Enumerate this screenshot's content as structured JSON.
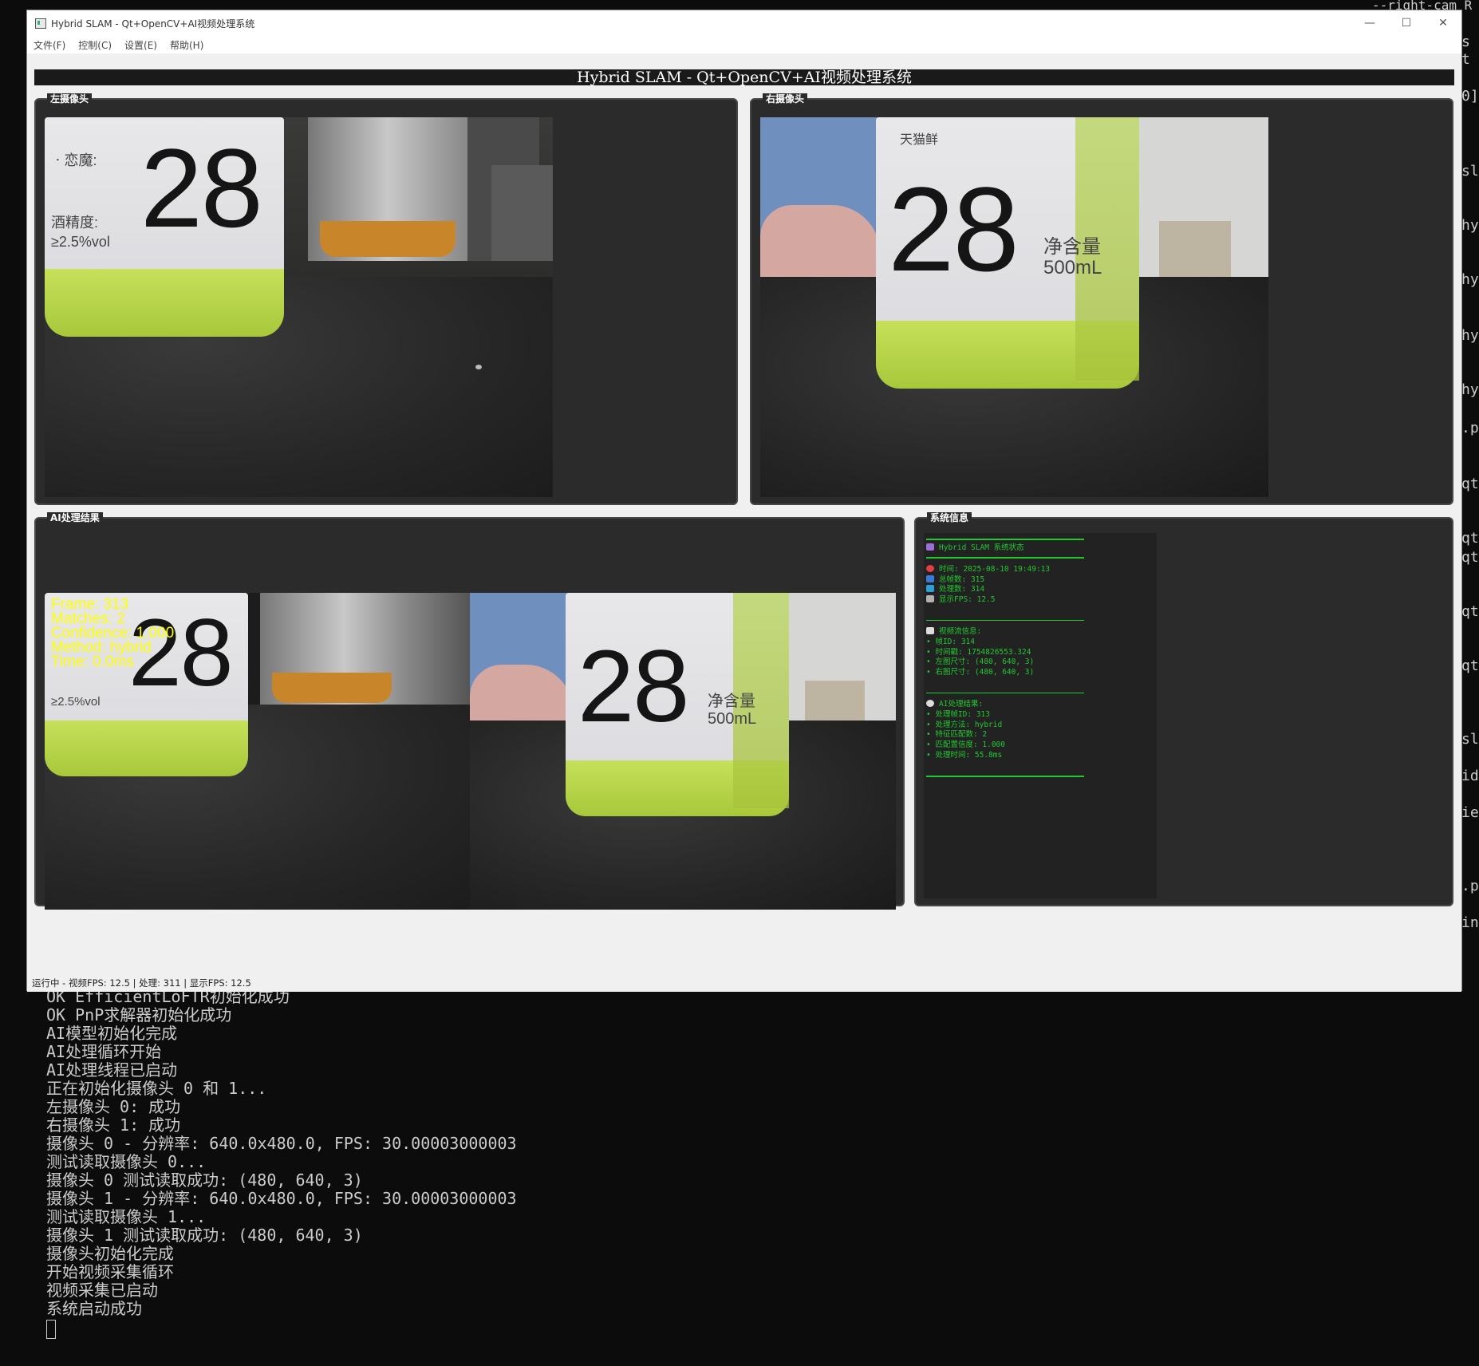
{
  "window": {
    "title": "Hybrid SLAM - Qt+OpenCV+AI视频处理系统",
    "controls": {
      "minimize": "—",
      "maximize": "☐",
      "close": "✕"
    }
  },
  "menu": [
    {
      "label": "文件(F)"
    },
    {
      "label": "控制(C)"
    },
    {
      "label": "设置(E)"
    },
    {
      "label": "帮助(H)"
    }
  ],
  "banner": "Hybrid SLAM - Qt+OpenCV+AI视频处理系统",
  "panels": {
    "left_camera": "左摄像头",
    "right_camera": "右摄像头",
    "ai_result": "AI处理结果",
    "system_info": "系统信息"
  },
  "camera_scene": {
    "bottle_number": "28",
    "left_label_small": "ㆍ恋魔:",
    "left_label_mid": "酒精度:",
    "left_label_alc": "≥2.5%vol",
    "right_label_volume": "净含量\n500mL",
    "right_label_brand": "天猫鲜"
  },
  "ai_overlay": {
    "frame": "Frame: 313",
    "matches": "Matches: 2",
    "confidence": "Confidence: 1.000",
    "method": "Method: hybrid",
    "time": "Time: 0.0ms"
  },
  "system_info": {
    "header": "Hybrid SLAM 系统状态",
    "time": "时间: 2025-08-10 19:49:13",
    "total_frames": "总帧数: 315",
    "processed": "处理数: 314",
    "display_fps": "显示FPS: 12.5",
    "video_title": "视频流信息:",
    "video_lines": [
      "• 帧ID: 314",
      "• 时间戳: 1754826553.324",
      "• 左图尺寸: (480, 640, 3)",
      "• 右图尺寸: (480, 640, 3)"
    ],
    "ai_title": "AI处理结果:",
    "ai_lines": [
      "• 处理帧ID: 313",
      "• 处理方法: hybrid",
      "• 特征匹配数: 2",
      "• 匹配置信度: 1.000",
      "• 处理时间: 55.8ms"
    ],
    "icon_colors": {
      "header": "#9b6fd6",
      "time": "#e04040",
      "total": "#3a7ad8",
      "processed": "#2aa0d8",
      "fps": "#b0b0b0",
      "video": "#dddddd",
      "ai": "#dddddd"
    }
  },
  "status_bar": "运行中 - 视频FPS: 12.5 | 处理: 311 | 显示FPS: 12.5",
  "terminal": {
    "lines": [
      "OK EfficientLoFTR初始化成功",
      "OK PnP求解器初始化成功",
      "AI模型初始化完成",
      "AI处理循环开始",
      "AI处理线程已启动",
      "正在初始化摄像头 0 和 1...",
      "左摄像头 0: 成功",
      "右摄像头 1: 成功",
      "摄像头 0 - 分辨率: 640.0x480.0, FPS: 30.00003000003",
      "测试读取摄像头 0...",
      "摄像头 0 测试读取成功: (480, 640, 3)",
      "摄像头 1 - 分辨率: 640.0x480.0, FPS: 30.00003000003",
      "测试读取摄像头 1...",
      "摄像头 1 测试读取成功: (480, 640, 3)",
      "摄像头初始化完成",
      "开始视频采集循环",
      "视频采集已启动",
      "系统启动成功"
    ],
    "top_right": "--right-cam R",
    "right_edge": [
      {
        "t": "s"
      },
      {
        "t": "t"
      },
      {
        "t": "0]"
      },
      {
        "t": "sl"
      },
      {
        "t": "hy"
      },
      {
        "t": "hy"
      },
      {
        "t": "hy"
      },
      {
        "t": "hy"
      },
      {
        "t": ".p"
      },
      {
        "t": "qt"
      },
      {
        "t": "qt"
      },
      {
        "t": "qt"
      },
      {
        "t": "qt"
      },
      {
        "t": "qt"
      },
      {
        "t": "sl"
      },
      {
        "t": "id"
      },
      {
        "t": "ie"
      },
      {
        "t": ".p"
      },
      {
        "t": "in"
      }
    ]
  }
}
